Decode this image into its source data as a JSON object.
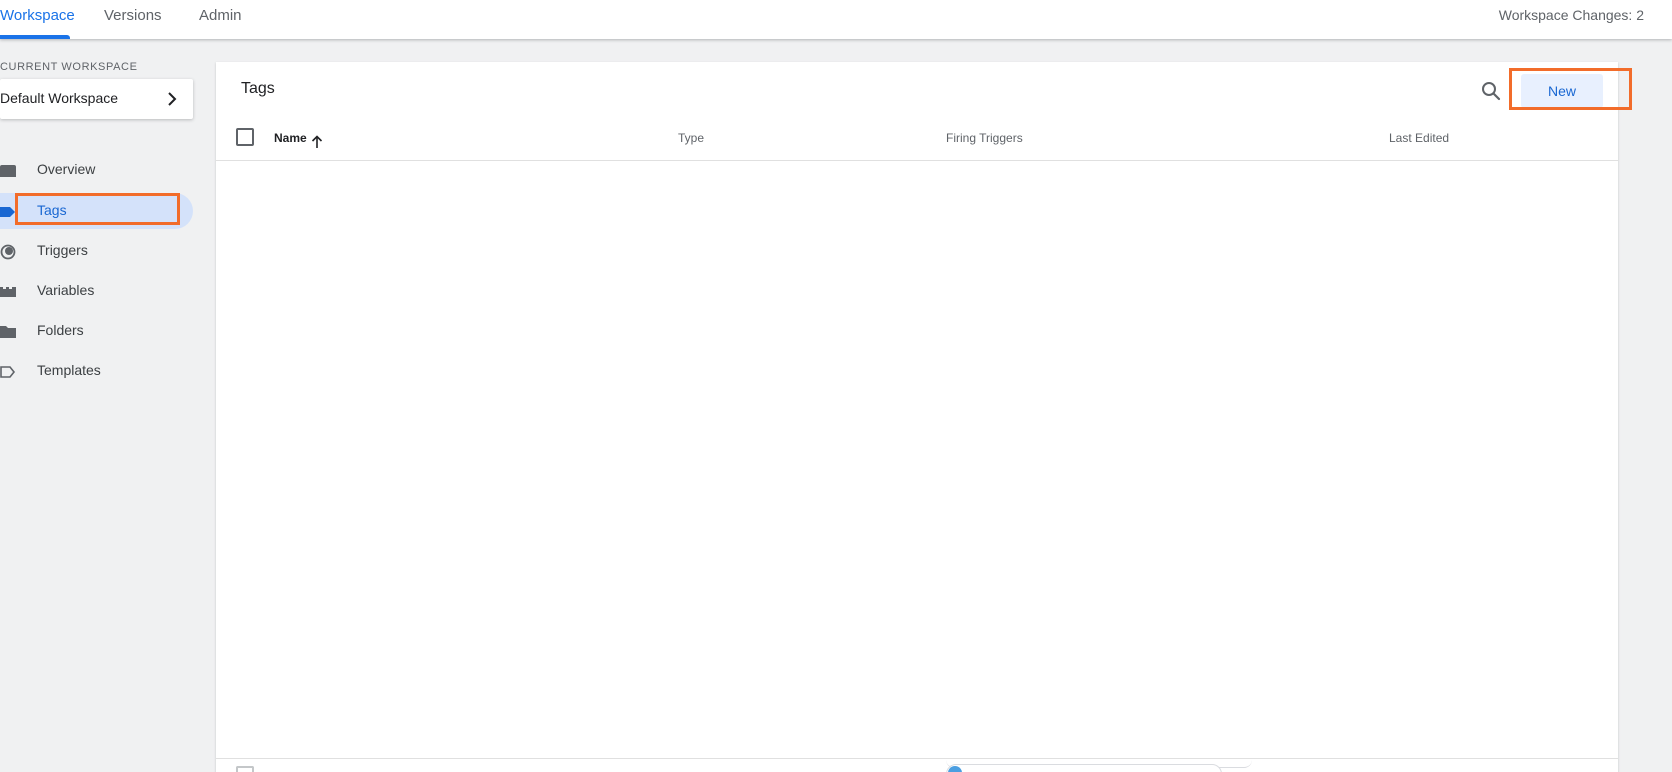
{
  "topbar": {
    "tabs": [
      {
        "label": "Workspace",
        "active": true
      },
      {
        "label": "Versions",
        "active": false
      },
      {
        "label": "Admin",
        "active": false
      }
    ],
    "workspace_changes": "Workspace Changes: 2"
  },
  "sidebar": {
    "current_workspace_label": "CURRENT WORKSPACE",
    "workspace_name": "Default Workspace",
    "items": [
      {
        "label": "Overview",
        "icon": "overview-icon",
        "active": false
      },
      {
        "label": "Tags",
        "icon": "tag-icon",
        "active": true
      },
      {
        "label": "Triggers",
        "icon": "trigger-icon",
        "active": false
      },
      {
        "label": "Variables",
        "icon": "variables-icon",
        "active": false
      },
      {
        "label": "Folders",
        "icon": "folder-icon",
        "active": false
      },
      {
        "label": "Templates",
        "icon": "template-icon",
        "active": false
      }
    ]
  },
  "main": {
    "title": "Tags",
    "new_button": "New",
    "columns": [
      "Name",
      "Type",
      "Firing Triggers",
      "Last Edited"
    ]
  },
  "colors": {
    "accent": "#1a73e8",
    "active_nav_bg": "#d4e2fa",
    "highlight": "#f26c2a"
  }
}
